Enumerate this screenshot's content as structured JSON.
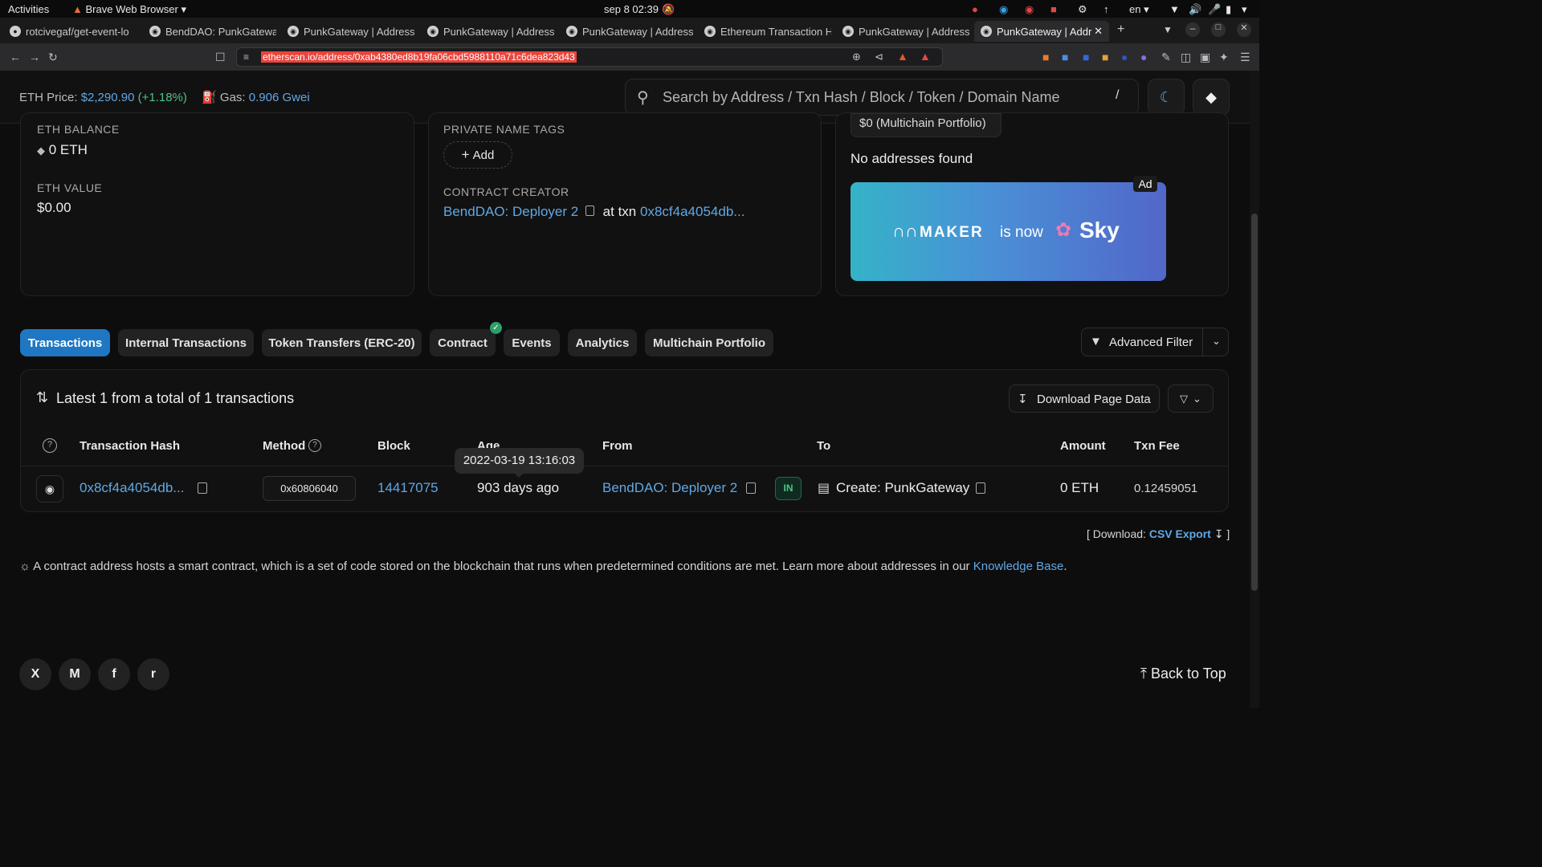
{
  "os": {
    "activities": "Activities",
    "browser_name": "Brave Web Browser",
    "clock": "sep 8  02:39",
    "lang": "en"
  },
  "tabs": [
    {
      "label": "rotcivegaf/get-event-lo",
      "icon": "github-icon"
    },
    {
      "label": "BendDAO: PunkGatewa",
      "icon": "etherscan-icon"
    },
    {
      "label": "PunkGateway | Address",
      "icon": "etherscan-icon"
    },
    {
      "label": "PunkGateway | Address",
      "icon": "etherscan-icon"
    },
    {
      "label": "PunkGateway | Address",
      "icon": "etherscan-icon"
    },
    {
      "label": "Ethereum Transaction H",
      "icon": "etherscan-icon"
    },
    {
      "label": "PunkGateway | Address",
      "icon": "etherscan-icon"
    },
    {
      "label": "PunkGateway | Addr",
      "icon": "etherscan-icon",
      "active": true
    }
  ],
  "url": "etherscan.io/address/0xab4380ed8b19fa06cbd5988110a71c6dea823d43",
  "header": {
    "eth_price_label": "ETH Price:",
    "eth_price_value": "$2,290.90",
    "eth_price_change": "(+1.18%)",
    "gas_label": "Gas:",
    "gas_value": "0.906 Gwei",
    "search_placeholder": "Search by Address / Txn Hash / Block / Token / Domain Name",
    "search_shortcut": "/"
  },
  "overview": {
    "eth_balance_label": "ETH BALANCE",
    "eth_balance_value": "0 ETH",
    "eth_value_label": "ETH VALUE",
    "eth_value_value": "$0.00"
  },
  "more_info": {
    "private_name_tags_label": "PRIVATE NAME TAGS",
    "add_button": "Add",
    "contract_creator_label": "CONTRACT CREATOR",
    "creator_name": "BendDAO: Deployer 2",
    "at_txn": "at txn",
    "creator_txn": "0x8cf4a4054db..."
  },
  "multichain": {
    "portfolio_label": "$0 (Multichain Portfolio)",
    "no_addresses": "No addresses found",
    "ad_badge": "Ad",
    "ad_text_maker": "MAKER",
    "ad_text_is_now": "is now",
    "ad_text_sky": "Sky"
  },
  "page_tabs": [
    {
      "label": "Transactions",
      "active": true
    },
    {
      "label": "Internal Transactions"
    },
    {
      "label": "Token Transfers (ERC-20)"
    },
    {
      "label": "Contract"
    },
    {
      "label": "Events"
    },
    {
      "label": "Analytics"
    },
    {
      "label": "Multichain Portfolio"
    }
  ],
  "advanced_filter": "Advanced Filter",
  "table": {
    "summary": "Latest 1 from a total of 1 transactions",
    "download_button": "Download Page Data",
    "headers": {
      "hash": "Transaction Hash",
      "method": "Method",
      "block": "Block",
      "age": "Age",
      "from": "From",
      "to": "To",
      "amount": "Amount",
      "fee": "Txn Fee"
    },
    "rows": [
      {
        "hash": "0x8cf4a4054db...",
        "method": "0x60806040",
        "block": "14417075",
        "age": "903 days ago",
        "age_tooltip": "2022-03-19 13:16:03",
        "from": "BendDAO: Deployer 2",
        "direction": "IN",
        "to": "Create: PunkGateway",
        "amount": "0 ETH",
        "fee": "0.12459051"
      }
    ]
  },
  "download": {
    "prefix": "[ Download:",
    "link": "CSV Export",
    "suffix": "]"
  },
  "info_note": {
    "text": "A contract address hosts a smart contract, which is a set of code stored on the blockchain that runs when predetermined conditions are met. Learn more about addresses in our",
    "link": "Knowledge Base",
    "period": "."
  },
  "footer": {
    "back_to_top": "Back to Top",
    "social_x": "X",
    "social_medium": "M",
    "social_facebook": "f",
    "social_reddit": "r"
  },
  "colors": {
    "accent_blue": "#61a8e6",
    "active_tab": "#1f77c3",
    "in_badge": "#2e9e6a"
  }
}
